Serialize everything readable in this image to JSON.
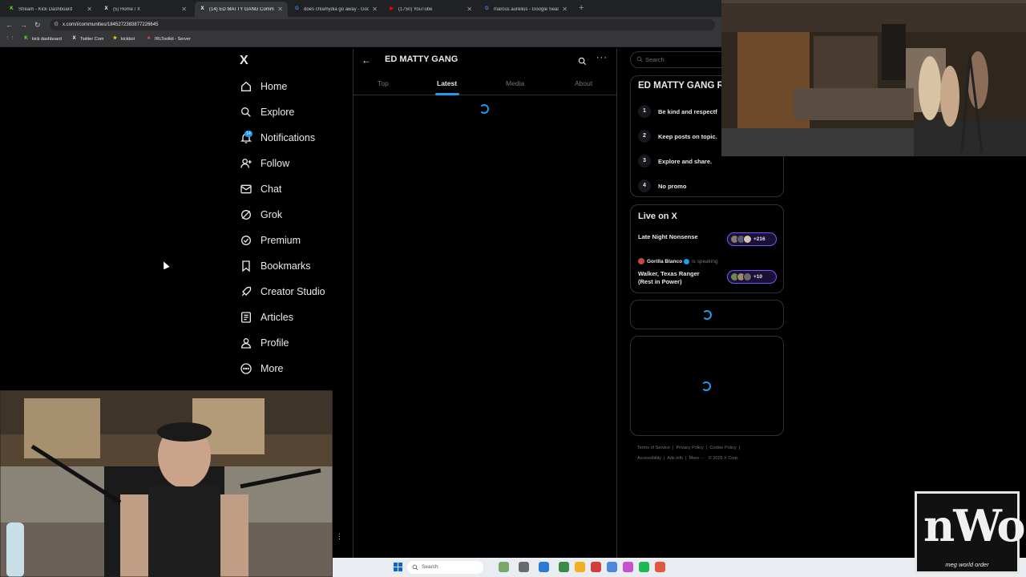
{
  "browser": {
    "tabs": [
      {
        "title": "Stream - Kick Dashboard",
        "icon": "kick-icon",
        "color": "#53fc18",
        "glyph": "K",
        "active": false
      },
      {
        "title": "(5) Home / X",
        "icon": "x-icon",
        "color": "#ffffff",
        "glyph": "X",
        "active": false
      },
      {
        "title": "(14) ED MATTY GANG Commu",
        "icon": "x-icon",
        "color": "#ffffff",
        "glyph": "X",
        "active": true
      },
      {
        "title": "does chlamydia go away - Goo",
        "icon": "google-icon",
        "color": "#4285f4",
        "glyph": "G",
        "active": false
      },
      {
        "title": "(1750) YouTube",
        "icon": "youtube-icon",
        "color": "#ff0000",
        "glyph": "▶",
        "active": false
      },
      {
        "title": "marcus aurelius - Google Searc",
        "icon": "google-icon",
        "color": "#4285f4",
        "glyph": "G",
        "active": false
      }
    ],
    "url": "x.com/i/communities/1845272383877226645",
    "bookmarks": [
      {
        "label": "kick dashboard",
        "icon": "kick-icon",
        "color": "#53fc18",
        "glyph": "K"
      },
      {
        "label": "Twitter Com",
        "icon": "x-icon",
        "color": "#ffffff",
        "glyph": "X"
      },
      {
        "label": "kickbot",
        "icon": "kickbot-icon",
        "color": "#ffd400",
        "glyph": "★"
      },
      {
        "label": "IRLToolkit - Server",
        "icon": "irltoolkit-icon",
        "color": "#e04040",
        "glyph": "■"
      }
    ]
  },
  "x_nav": {
    "items": [
      {
        "label": "Home",
        "icon": "home-icon"
      },
      {
        "label": "Explore",
        "icon": "search-icon"
      },
      {
        "label": "Notifications",
        "icon": "bell-icon"
      },
      {
        "label": "Follow",
        "icon": "follow-icon"
      },
      {
        "label": "Chat",
        "icon": "mail-icon"
      },
      {
        "label": "Grok",
        "icon": "grok-icon"
      },
      {
        "label": "Premium",
        "icon": "verified-icon"
      },
      {
        "label": "Bookmarks",
        "icon": "bookmark-icon"
      },
      {
        "label": "Creator Studio",
        "icon": "rocket-icon"
      },
      {
        "label": "Articles",
        "icon": "article-icon"
      },
      {
        "label": "Profile",
        "icon": "user-icon"
      },
      {
        "label": "More",
        "icon": "more-circle-icon"
      }
    ],
    "notification_count": "14"
  },
  "community": {
    "name": "ED MATTY GANG",
    "tabs": [
      "Top",
      "Latest",
      "Media",
      "About"
    ],
    "active_tab": "Latest"
  },
  "sidebar": {
    "search_placeholder": "Search",
    "rules_title": "ED MATTY GANG Ru",
    "rules": [
      {
        "num": "1",
        "text": "Be kind and respectf"
      },
      {
        "num": "2",
        "text": "Keep posts on topic."
      },
      {
        "num": "3",
        "text": "Explore and share."
      },
      {
        "num": "4",
        "text": "No promo"
      }
    ],
    "live_title": "Live on X",
    "spaces": [
      {
        "title": "Late Night Nonsense",
        "count": "+216"
      },
      {
        "title": "Walker, Texas Ranger\n(Rest in Power)",
        "count": "+10",
        "host": "Gorilla Blanco",
        "status": "is speaking"
      }
    ],
    "footer_line1": [
      "Terms of Service",
      "Privacy Policy",
      "Cookie Policy"
    ],
    "footer_line2": [
      "Accessibility",
      "Ads info",
      "More ···",
      "© 2025 X Corp."
    ]
  },
  "taskbar": {
    "search_label": "Search"
  },
  "overlay_logo": {
    "big": "nWo",
    "sub": "meg world order"
  }
}
